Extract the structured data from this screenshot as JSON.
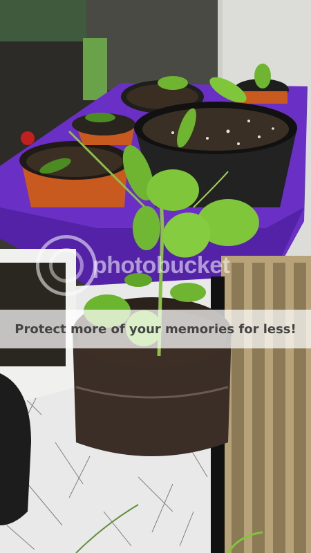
{
  "photo": {
    "subject": "pea-seedlings-in-pots",
    "colors": {
      "leaf": "#7fc63a",
      "leaf_dark": "#4c8a22",
      "tray": "#6a2fc4",
      "soil": "#2e241c",
      "pot_orange": "#c85a20"
    }
  },
  "watermark": {
    "logo_text": "photobucket",
    "banner_text": "Protect more of your memories for less!"
  }
}
